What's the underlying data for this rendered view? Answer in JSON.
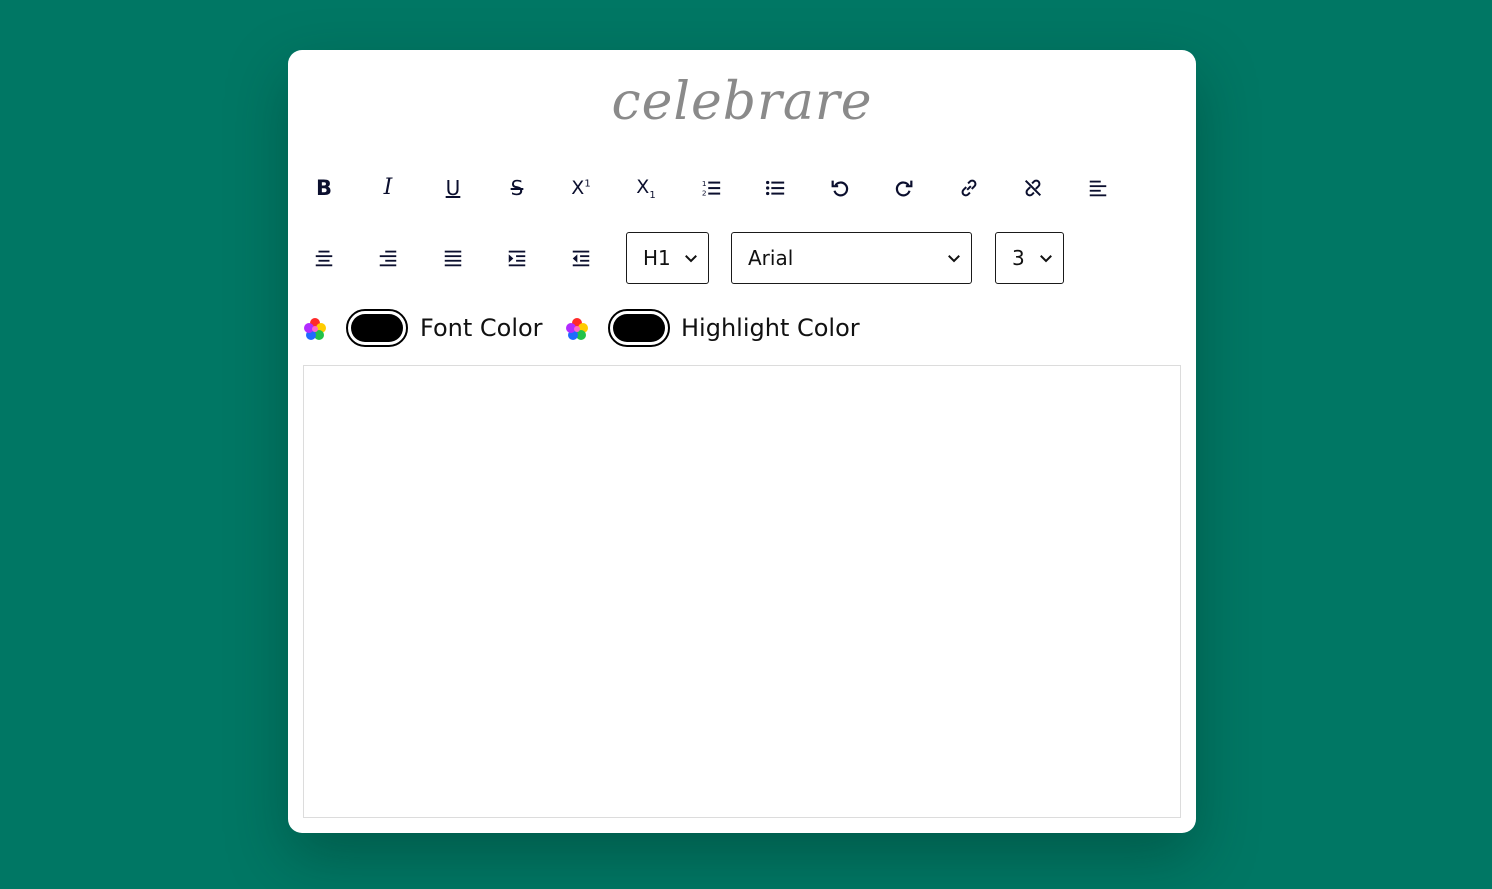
{
  "app": {
    "logo": "celebrare"
  },
  "toolbar": {
    "buttons": [
      {
        "name": "bold-button",
        "icon": "bold-icon",
        "glyph": "B"
      },
      {
        "name": "italic-button",
        "icon": "italic-icon",
        "glyph": "I"
      },
      {
        "name": "underline-button",
        "icon": "underline-icon",
        "glyph": "U"
      },
      {
        "name": "strikethrough-button",
        "icon": "strikethrough-icon",
        "glyph": "S"
      },
      {
        "name": "superscript-button",
        "icon": "superscript-icon"
      },
      {
        "name": "subscript-button",
        "icon": "subscript-icon"
      },
      {
        "name": "ordered-list-button",
        "icon": "ordered-list-icon"
      },
      {
        "name": "unordered-list-button",
        "icon": "unordered-list-icon"
      },
      {
        "name": "undo-button",
        "icon": "undo-icon"
      },
      {
        "name": "redo-button",
        "icon": "redo-icon"
      },
      {
        "name": "link-button",
        "icon": "link-icon"
      },
      {
        "name": "unlink-button",
        "icon": "unlink-icon"
      },
      {
        "name": "align-left-button",
        "icon": "align-left-icon"
      },
      {
        "name": "align-center-button",
        "icon": "align-center-icon"
      },
      {
        "name": "align-right-button",
        "icon": "align-right-icon"
      },
      {
        "name": "align-justify-button",
        "icon": "align-justify-icon"
      },
      {
        "name": "indent-button",
        "icon": "indent-icon"
      },
      {
        "name": "outdent-button",
        "icon": "outdent-icon"
      }
    ],
    "superscript": {
      "base": "X",
      "sup": "1"
    },
    "subscript": {
      "base": "X",
      "sub": "1"
    },
    "heading_select": {
      "value": "H1"
    },
    "font_select": {
      "value": "Arial"
    },
    "size_select": {
      "value": "3"
    }
  },
  "colors": {
    "font_color_label": "Font Color",
    "highlight_color_label": "Highlight Color",
    "font_color_value": "#000000",
    "highlight_color_value": "#000000",
    "background": "#007764"
  },
  "editor": {
    "content": ""
  }
}
